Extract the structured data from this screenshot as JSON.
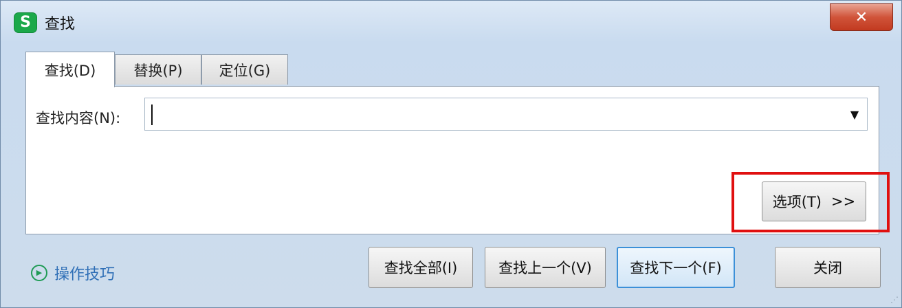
{
  "window": {
    "title": "查找",
    "icon_letter": "S",
    "close_glyph": "✕"
  },
  "tabs": [
    {
      "label": "查找(D)",
      "active": true
    },
    {
      "label": "替换(P)",
      "active": false
    },
    {
      "label": "定位(G)",
      "active": false
    }
  ],
  "find": {
    "label": "查找内容(N):",
    "value": ""
  },
  "options_button": {
    "label": "选项(T)",
    "arrows": ">>"
  },
  "tips": {
    "label": "操作技巧"
  },
  "buttons": {
    "find_all": "查找全部(I)",
    "find_prev": "查找上一个(V)",
    "find_next": "查找下一个(F)",
    "close": "关闭"
  },
  "colors": {
    "highlight": "#e01010",
    "accent": "#3c90d8",
    "app_icon": "#1ba84a"
  }
}
